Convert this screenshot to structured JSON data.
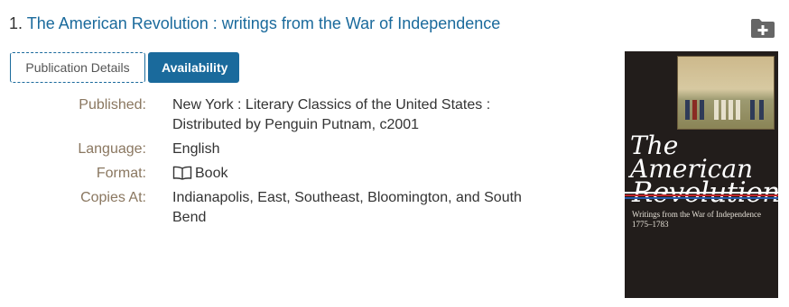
{
  "result": {
    "number": "1.",
    "title": "The American Revolution : writings from the War of Independence"
  },
  "tabs": {
    "details": "Publication Details",
    "availability": "Availability"
  },
  "details": {
    "published_label": "Published:",
    "published_value": "New York : Literary Classics of the United States : Distributed by Penguin Putnam, c2001",
    "language_label": "Language:",
    "language_value": "English",
    "format_label": "Format:",
    "format_value": "Book",
    "copies_label": "Copies At:",
    "copies_value": "Indianapolis, East, Southeast, Bloomington, and South Bend"
  },
  "cover": {
    "title_line1": "The American",
    "title_line2": "Revolution",
    "subtitle": "Writings from the War of Independence",
    "years": "1775–1783"
  },
  "colors": {
    "link": "#1a6a9c",
    "label": "#8a7760",
    "icon": "#666666"
  },
  "icons": {
    "folder": "folder-plus-icon",
    "book": "book-icon"
  }
}
